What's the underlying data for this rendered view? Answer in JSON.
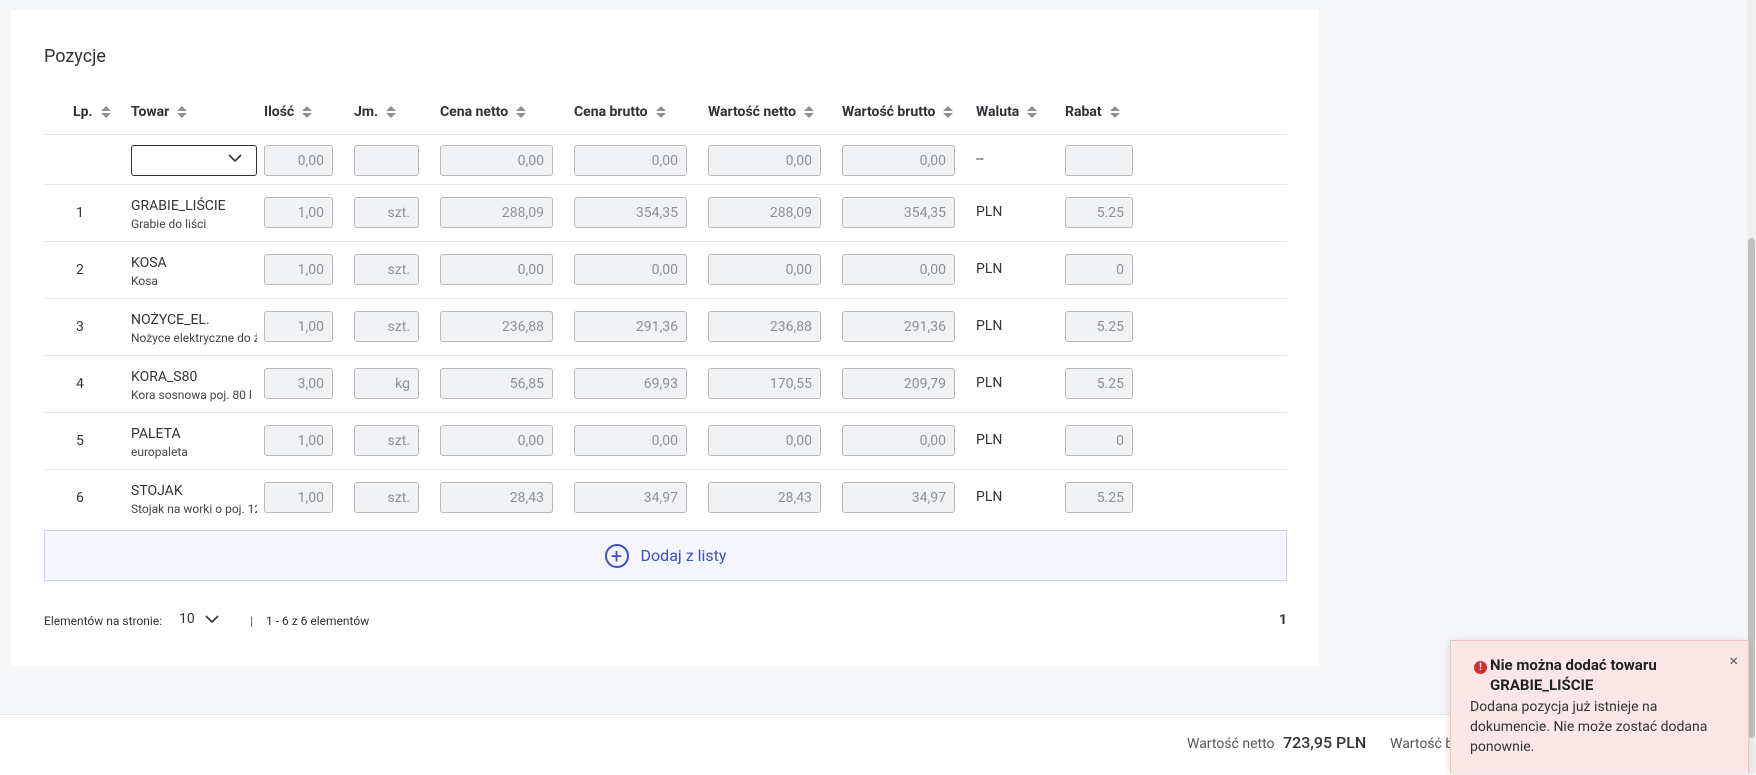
{
  "section_title": "Pozycje",
  "columns": [
    {
      "key": "lp",
      "label": "Lp."
    },
    {
      "key": "towar",
      "label": "Towar"
    },
    {
      "key": "ilosc",
      "label": "Ilość"
    },
    {
      "key": "jm",
      "label": "Jm."
    },
    {
      "key": "cena_netto",
      "label": "Cena netto"
    },
    {
      "key": "cena_brutto",
      "label": "Cena brutto"
    },
    {
      "key": "wartosc_netto",
      "label": "Wartość netto"
    },
    {
      "key": "wartosc_brutto",
      "label": "Wartość brutto"
    },
    {
      "key": "waluta",
      "label": "Waluta"
    },
    {
      "key": "rabat",
      "label": "Rabat"
    }
  ],
  "new_row": {
    "ilosc": "0,00",
    "jm": "",
    "cena_netto": "0,00",
    "cena_brutto": "0,00",
    "wartosc_netto": "0,00",
    "wartosc_brutto": "0,00",
    "waluta": "--",
    "rabat": ""
  },
  "rows": [
    {
      "lp": "1",
      "code": "GRABIE_LIŚCIE",
      "desc": "Grabie do liści",
      "ilosc": "1,00",
      "jm": "szt.",
      "cena_netto": "288,09",
      "cena_brutto": "354,35",
      "wartosc_netto": "288,09",
      "wartosc_brutto": "354,35",
      "waluta": "PLN",
      "rabat": "5.25"
    },
    {
      "lp": "2",
      "code": "KOSA",
      "desc": "Kosa",
      "ilosc": "1,00",
      "jm": "szt.",
      "cena_netto": "0,00",
      "cena_brutto": "0,00",
      "wartosc_netto": "0,00",
      "wartosc_brutto": "0,00",
      "waluta": "PLN",
      "rabat": "0"
    },
    {
      "lp": "3",
      "code": "NOŻYCE_EL.",
      "desc": "Nożyce elektryczne do ż",
      "ilosc": "1,00",
      "jm": "szt.",
      "cena_netto": "236,88",
      "cena_brutto": "291,36",
      "wartosc_netto": "236,88",
      "wartosc_brutto": "291,36",
      "waluta": "PLN",
      "rabat": "5.25"
    },
    {
      "lp": "4",
      "code": "KORA_S80",
      "desc": "Kora sosnowa poj. 80 l",
      "ilosc": "3,00",
      "jm": "kg",
      "cena_netto": "56,85",
      "cena_brutto": "69,93",
      "wartosc_netto": "170,55",
      "wartosc_brutto": "209,79",
      "waluta": "PLN",
      "rabat": "5.25"
    },
    {
      "lp": "5",
      "code": "PALETA",
      "desc": "europaleta",
      "ilosc": "1,00",
      "jm": "szt.",
      "cena_netto": "0,00",
      "cena_brutto": "0,00",
      "wartosc_netto": "0,00",
      "wartosc_brutto": "0,00",
      "waluta": "PLN",
      "rabat": "0"
    },
    {
      "lp": "6",
      "code": "STOJAK",
      "desc": "Stojak na worki o poj. 12",
      "ilosc": "1,00",
      "jm": "szt.",
      "cena_netto": "28,43",
      "cena_brutto": "34,97",
      "wartosc_netto": "28,43",
      "wartosc_brutto": "34,97",
      "waluta": "PLN",
      "rabat": "5.25"
    }
  ],
  "add_button_label": "Dodaj z listy",
  "pager": {
    "per_page_label": "Elementów na stronie:",
    "per_page_value": "10",
    "separator": "|",
    "range_text": "1 - 6 z 6 elementów",
    "current_page": "1"
  },
  "footer": {
    "net_label": "Wartość netto",
    "net_value": "723,95 PLN",
    "gross_label": "Wartość b"
  },
  "toast": {
    "title": "Nie można dodać towaru GRABIE_LIŚCIE",
    "message": "Dodana pozycja już istnieje na dokumencie. Nie może zostać dodana ponownie.",
    "close": "×",
    "icon": "error-icon",
    "error_color": "#d32f2f"
  },
  "colors": {
    "accent": "#3d4fc6",
    "toast_bg": "#fbe7e7"
  }
}
